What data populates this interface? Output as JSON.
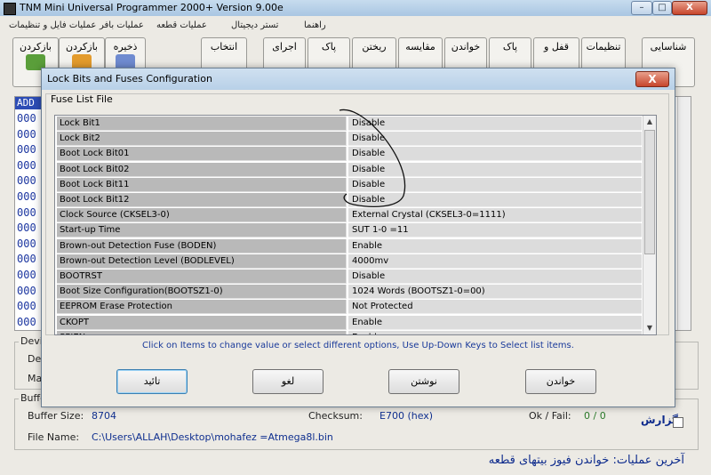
{
  "app": {
    "title": "TNM Mini Universal Programmer 2000+   Version 9.00e",
    "window_buttons": [
      "–",
      "□",
      "X"
    ]
  },
  "menu": [
    "عملیات فایل و تنظیمات",
    "عملیات بافر",
    "عملیات قطعه",
    "تستر دیجیتال",
    "راهنما"
  ],
  "toolbar": {
    "buttons": [
      {
        "label": "بازکردن"
      },
      {
        "label": "بازکردن"
      },
      {
        "label": "ذخیره"
      },
      {
        "label": "انتخاب"
      },
      {
        "label": "اجرای"
      },
      {
        "label": "پاک"
      },
      {
        "label": "ریختن"
      },
      {
        "label": "مقایسه"
      },
      {
        "label": "خواندن"
      },
      {
        "label": "پاک"
      },
      {
        "label": "قفل و"
      },
      {
        "label": "تنظیمات"
      },
      {
        "label": "شناسایی"
      }
    ],
    "partial_label": "فایل"
  },
  "hex_pane": {
    "header": "ADD",
    "addresses": [
      "000",
      "000",
      "000",
      "000",
      "000",
      "000",
      "000",
      "000",
      "000",
      "000",
      "000",
      "000",
      "000",
      "000"
    ]
  },
  "device_group": {
    "caption": "Devic",
    "row1": "Dev",
    "row2": "Ma"
  },
  "buffer_group": {
    "caption": "Buffer",
    "buffer_size_label": "Buffer Size:",
    "buffer_size_value": "8704",
    "checksum_label": "Checksum:",
    "checksum_value": "E700 (hex)",
    "okfail_label": "Ok / Fail:",
    "okfail_value": "0 / 0",
    "file_name_label": "File Name:",
    "file_name_value": "C:\\Users\\ALLAH\\Desktop\\mohafez =Atmega8l.bin",
    "report_label": "گزارش"
  },
  "status_line": "آخرین عملیات:  خواندن فیوز بیتهای قطعه",
  "dialog": {
    "title": "Lock Bits and Fuses Configuration",
    "close": "X",
    "group_caption": "Fuse List File",
    "fuses": [
      {
        "name": "Lock Bit1",
        "value": "Disable"
      },
      {
        "name": "Lock Bit2",
        "value": "Disable"
      },
      {
        "name": "Boot Lock Bit01",
        "value": "Disable"
      },
      {
        "name": "Boot Lock Bit02",
        "value": "Disable"
      },
      {
        "name": "Boot Lock Bit11",
        "value": "Disable"
      },
      {
        "name": "Boot Lock Bit12",
        "value": "Disable"
      },
      {
        "name": "Clock Source (CKSEL3-0)",
        "value": "External Crystal (CKSEL3-0=1111)"
      },
      {
        "name": "Start-up Time",
        "value": "SUT 1-0 =11"
      },
      {
        "name": "Brown-out Detection Fuse (BODEN)",
        "value": "Enable"
      },
      {
        "name": "Brown-out Detection Level (BODLEVEL)",
        "value": "4000mv"
      },
      {
        "name": "BOOTRST",
        "value": "Disable"
      },
      {
        "name": "Boot Size Configuration(BOOTSZ1-0)",
        "value": "1024 Words (BOOTSZ1-0=00)"
      },
      {
        "name": "EEPROM Erase Protection",
        "value": "Not Protected"
      },
      {
        "name": "CKOPT",
        "value": "Enable"
      },
      {
        "name": "SPIEN",
        "value": "Enable"
      }
    ],
    "hint": "Click on Items to change value or select different options, Use Up-Down Keys to Select list items.",
    "buttons": {
      "ok": "تائید",
      "cancel": "لغو",
      "write": "نوشتن",
      "read": "خواندن"
    }
  }
}
